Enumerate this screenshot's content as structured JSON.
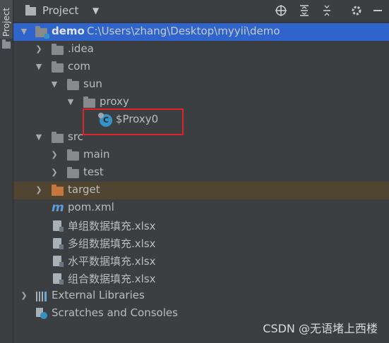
{
  "sidebar": {
    "tab_label": "Project"
  },
  "header": {
    "title": "Project",
    "dropdown_glyph": "▼",
    "icons": [
      "crosshair-icon",
      "expand-all-icon",
      "collapse-all-icon",
      "gear-icon",
      "hide-icon"
    ]
  },
  "tree": {
    "root": {
      "name": "demo",
      "path": "C:\\Users\\zhang\\Desktop\\myyii\\demo"
    },
    "idea": ".idea",
    "com": "com",
    "sun": "sun",
    "proxy": "proxy",
    "proxy_class": "$Proxy0",
    "class_icon_letter": "C",
    "src": "src",
    "main": "main",
    "test": "test",
    "target": "target",
    "pom_icon": "m",
    "pom": "pom.xml",
    "files": [
      "单组数据填充.xlsx",
      "多组数据填充.xlsx",
      "水平数据填充.xlsx",
      "组合数据填充.xlsx"
    ],
    "external_libraries": "External Libraries",
    "scratches": "Scratches and Consoles"
  },
  "watermark": "CSDN @无语堵上西楼",
  "colors": {
    "selection": "#2f65ca",
    "excluded_folder": "#c6773e",
    "highlight": "#e0222a",
    "class_icon": "#3592c4"
  }
}
